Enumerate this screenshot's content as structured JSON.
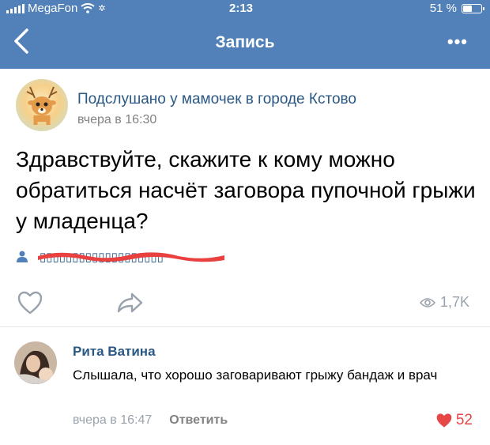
{
  "status_bar": {
    "carrier": "MegaFon",
    "time": "2:13",
    "battery": "51 %",
    "battery_level": 0.51
  },
  "navbar": {
    "title": "Запись"
  },
  "post": {
    "group_name": "Подслушано у мамочек в городе Кстово",
    "date": "вчера в 16:30",
    "text": "Здравствуйте, скажите к кому можно обратиться насчёт заговора пупочной грыжи у младенца?",
    "views": "1,7K"
  },
  "comment": {
    "author": "Рита Ватина",
    "text": "Слышала, что хорошо заговаривают грыжу бандаж и врач",
    "date": "вчера в 16:47",
    "reply_label": "Ответить",
    "likes": "52"
  },
  "colors": {
    "header": "#5181b8",
    "link": "#2a5885",
    "like": "#e64646",
    "muted": "#9aa3ad",
    "redaction": "#e8413f"
  }
}
